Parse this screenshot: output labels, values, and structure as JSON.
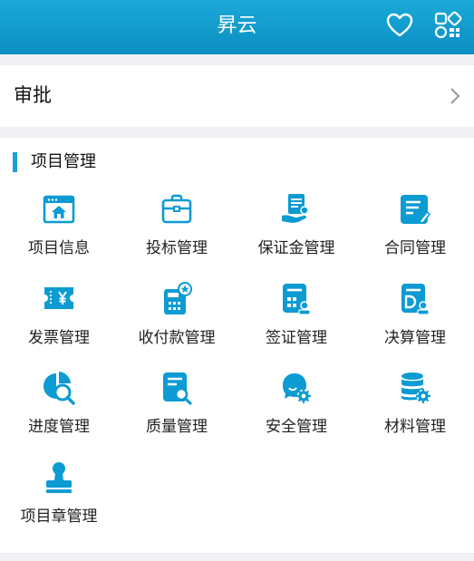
{
  "header": {
    "title": "昇云"
  },
  "approval": {
    "label": "审批"
  },
  "section": {
    "title": "项目管理",
    "items": [
      {
        "label": "项目信息"
      },
      {
        "label": "投标管理"
      },
      {
        "label": "保证金管理"
      },
      {
        "label": "合同管理"
      },
      {
        "label": "发票管理"
      },
      {
        "label": "收付款管理"
      },
      {
        "label": "签证管理"
      },
      {
        "label": "决算管理"
      },
      {
        "label": "进度管理"
      },
      {
        "label": "质量管理"
      },
      {
        "label": "安全管理"
      },
      {
        "label": "材料管理"
      },
      {
        "label": "项目章管理"
      }
    ]
  },
  "colors": {
    "accent": "#0c9bd3",
    "header": "#1aa9d8"
  }
}
